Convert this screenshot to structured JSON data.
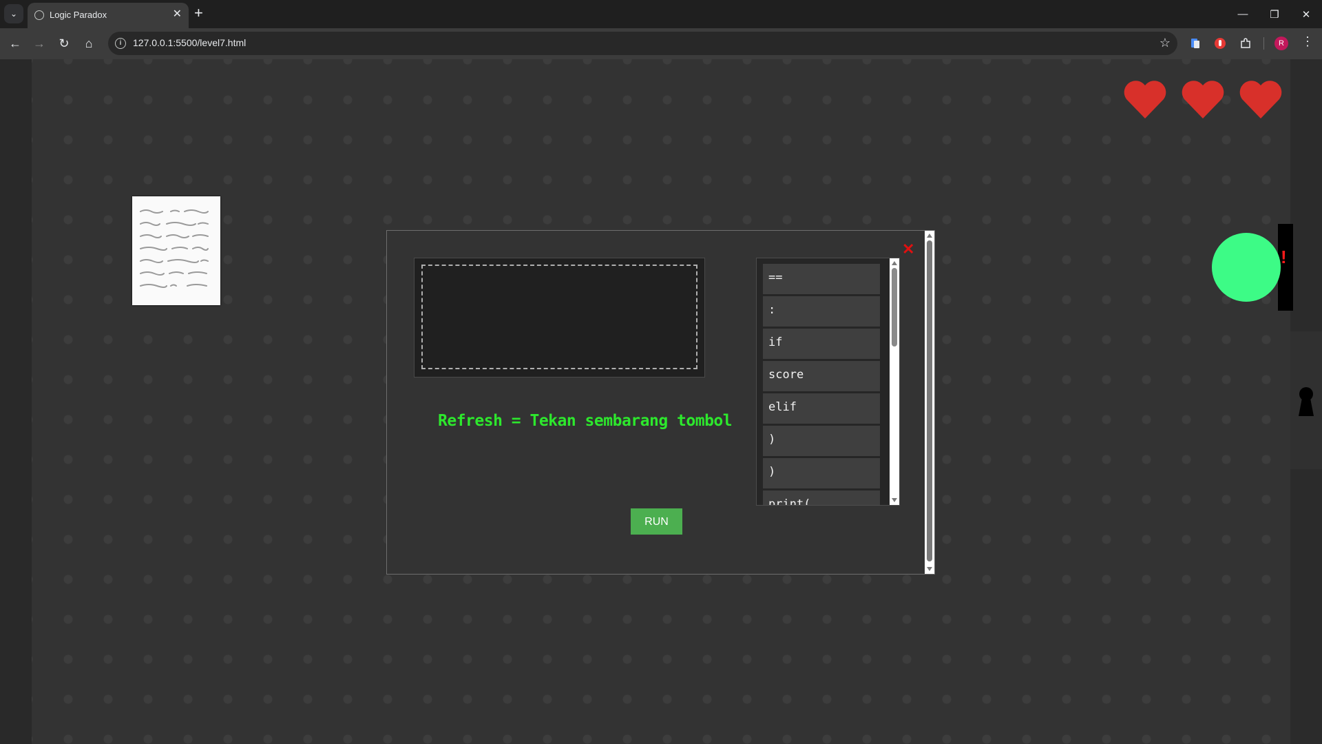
{
  "browser": {
    "tab_title": "Logic Paradox",
    "url": "127.0.0.1:5500/level7.html",
    "profile_initial": "R"
  },
  "game": {
    "lives": 3,
    "heart_color": "#d8302a",
    "npc_color": "#3dfb86",
    "npc_alert": "!"
  },
  "modal": {
    "hint": "Refresh = Tekan sembarang tombol",
    "run_label": "RUN",
    "blocks": [
      "==",
      ":",
      "if",
      "score",
      "elif",
      ")",
      ")",
      "print("
    ]
  }
}
